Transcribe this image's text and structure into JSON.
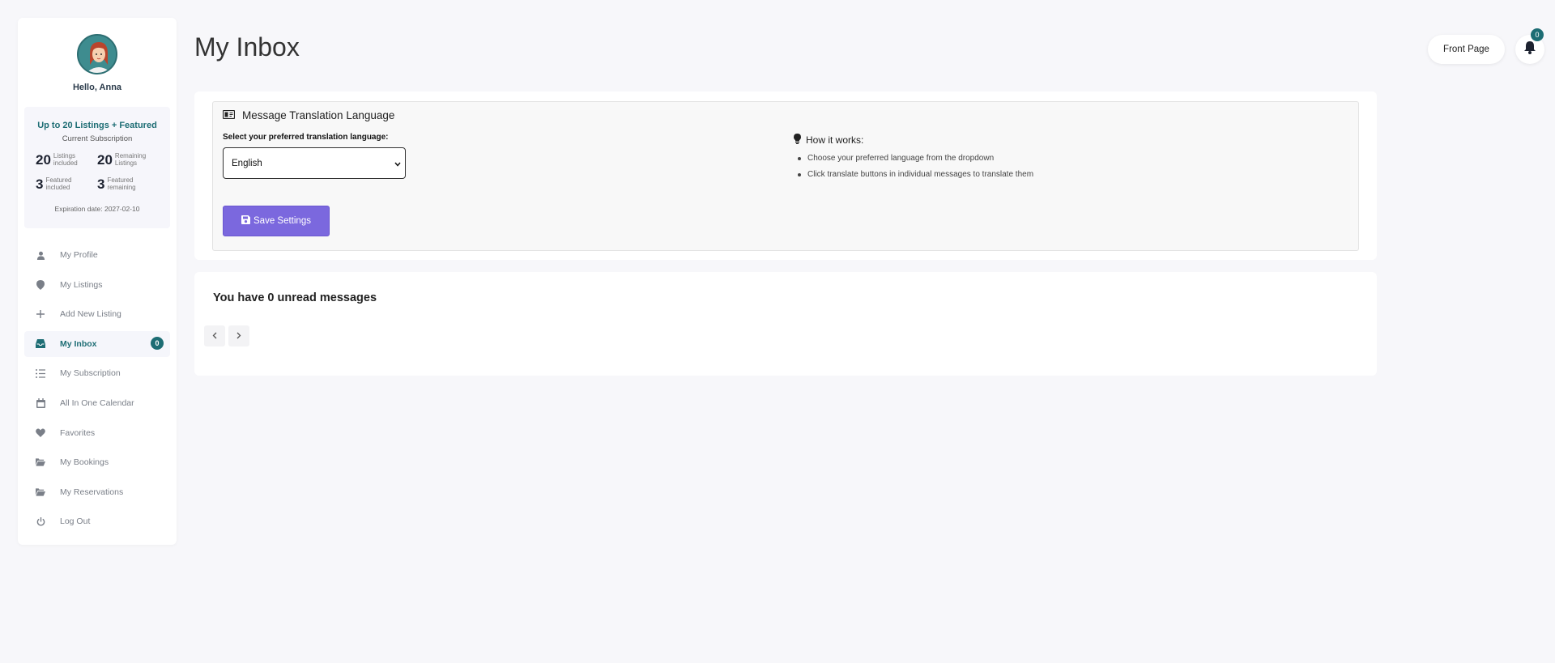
{
  "page": {
    "title": "My Inbox"
  },
  "header": {
    "front_page_label": "Front Page",
    "notification_count": "0"
  },
  "sidebar": {
    "greeting": "Hello, Anna",
    "subscription": {
      "plan": "Up to 20 Listings + Featured",
      "label": "Current Subscription",
      "listings_included": "20",
      "listings_included_label": "Listings included",
      "remaining_listings": "20",
      "remaining_listings_label": "Remaining Listings",
      "featured_included": "3",
      "featured_included_label": "Featured included",
      "featured_remaining": "3",
      "featured_remaining_label": "Featured remaining",
      "expiry": "Expiration date: 2027-02-10"
    },
    "nav": [
      {
        "label": "My Profile",
        "icon": "user-icon"
      },
      {
        "label": "My Listings",
        "icon": "map-pin-icon"
      },
      {
        "label": "Add New Listing",
        "icon": "plus-icon"
      },
      {
        "label": "My Inbox",
        "icon": "inbox-icon",
        "active": true,
        "badge": "0"
      },
      {
        "label": "My Subscription",
        "icon": "list-check-icon"
      },
      {
        "label": "All In One Calendar",
        "icon": "calendar-icon"
      },
      {
        "label": "Favorites",
        "icon": "heart-icon"
      },
      {
        "label": "My Bookings",
        "icon": "folder-open-icon"
      },
      {
        "label": "My Reservations",
        "icon": "folder-open-icon"
      },
      {
        "label": "Log Out",
        "icon": "power-icon"
      }
    ]
  },
  "translation": {
    "title": "Message Translation Language",
    "select_label": "Select your preferred translation language:",
    "selected_language": "English",
    "save_label": "Save Settings",
    "how_title": "How it works:",
    "how_steps": [
      "Choose your preferred language from the dropdown",
      "Click translate buttons in individual messages to translate them"
    ]
  },
  "messages": {
    "unread_text": "You have 0 unread messages"
  },
  "colors": {
    "accent": "#1d6d74",
    "button": "#7b68de",
    "background": "#f7f7fa"
  }
}
